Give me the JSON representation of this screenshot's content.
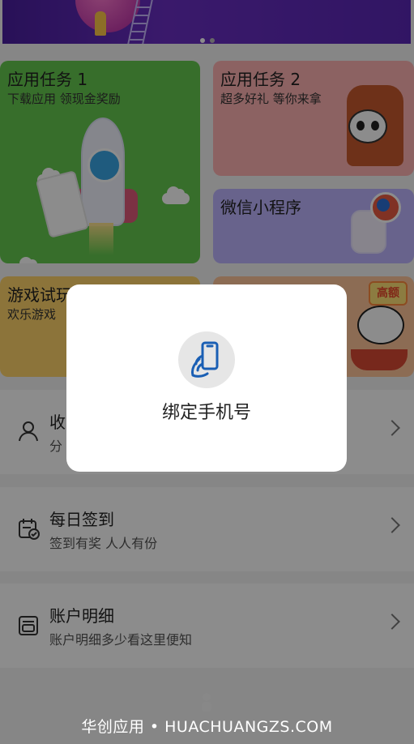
{
  "banner": {
    "pagination": {
      "active_index": 0,
      "count": 2
    }
  },
  "cards": [
    {
      "id": "task1",
      "title": "应用任务 1",
      "subtitle": "下载应用 领现金奖励"
    },
    {
      "id": "task2",
      "title": "应用任务 2",
      "subtitle": "超多好礼 等你来拿"
    },
    {
      "id": "wechat",
      "title": "微信小程序"
    },
    {
      "id": "game",
      "title": "游戏试玩",
      "subtitle": "欢乐游戏"
    },
    {
      "id": "high",
      "badge": "高额"
    }
  ],
  "list": [
    {
      "id": "collect",
      "icon": "user-icon",
      "label": "收",
      "desc": "分"
    },
    {
      "id": "checkin",
      "icon": "calendar-check-icon",
      "label": "每日签到",
      "desc": "签到有奖 人人有份"
    },
    {
      "id": "account",
      "icon": "wallet-icon",
      "label": "账户明细",
      "desc": "账户明细多少看这里便知"
    }
  ],
  "modal": {
    "icon": "hand-phone-icon",
    "title": "绑定手机号"
  },
  "footer": {
    "watermark": "华创应用 • HUACHUANGZS.COM"
  },
  "colors": {
    "task1_bg": "#65c94f",
    "task2_bg": "#ffb3b3",
    "wechat_bg": "#bdb4ff",
    "game_bg": "#ffd46a",
    "high_bg": "#ffc59a",
    "overlay": "rgba(0,0,0,0.45)"
  }
}
